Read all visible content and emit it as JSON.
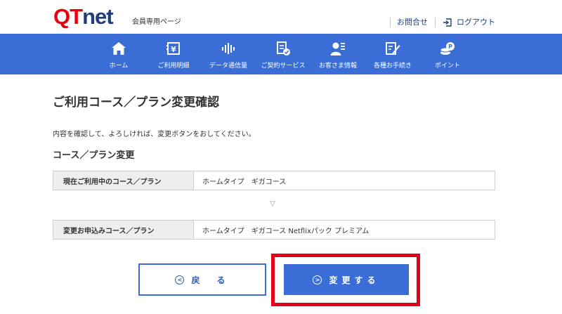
{
  "header": {
    "logo_qt": "QT",
    "logo_net": "net",
    "subtitle": "会員専用ページ",
    "contact_label": "お問合せ",
    "logout_label": "ログアウト"
  },
  "nav": {
    "items": [
      {
        "label": "ホーム",
        "icon": "home-icon"
      },
      {
        "label": "ご利用明細",
        "icon": "statement-icon"
      },
      {
        "label": "データ通信量",
        "icon": "data-usage-icon"
      },
      {
        "label": "ご契約サービス",
        "icon": "contract-icon"
      },
      {
        "label": "お客さま情報",
        "icon": "customer-info-icon"
      },
      {
        "label": "各種お手続き",
        "icon": "procedures-icon"
      },
      {
        "label": "ポイント",
        "icon": "points-icon"
      }
    ]
  },
  "main": {
    "title": "ご利用コース／プラン変更確認",
    "intro": "内容を確認して、よろしければ、変更ボタンをおしてください。",
    "section_title": "コース／プラン変更",
    "current_label": "現在ご利用中のコース／プラン",
    "current_value": "ホームタイプ　ギガコース",
    "arrow": "▽",
    "new_label": "変更お申込みコース／プラン",
    "new_value": "ホームタイプ　ギガコース Netflixパック プレミアム"
  },
  "buttons": {
    "back_label": "戻　る",
    "change_label": "変更する"
  },
  "colors": {
    "brand_red": "#e60012",
    "brand_navy": "#1f3d7a",
    "nav_blue": "#3a6ed6",
    "highlight_red": "#e3001b"
  }
}
